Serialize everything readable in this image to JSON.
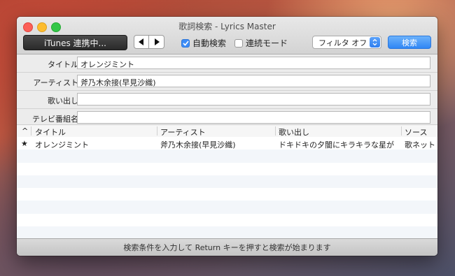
{
  "window": {
    "title": "歌詞検索 - Lyrics Master"
  },
  "toolbar": {
    "itunes_label": "iTunes 連携中...",
    "auto_search_label": "自動検索",
    "auto_search_checked": true,
    "continuous_label": "連続モード",
    "continuous_checked": false,
    "filter_value": "フィルタ オフ",
    "search_label": "検索"
  },
  "form": {
    "title_label": "タイトル",
    "title_value": "オレンジミント",
    "artist_label": "アーティスト",
    "artist_value": "斧乃木余接(早見沙織)",
    "intro_label": "歌い出し",
    "intro_value": "",
    "tv_label": "テレビ番組名",
    "tv_value": ""
  },
  "table": {
    "sort_indicator": "^",
    "columns": [
      "タイトル",
      "アーティスト",
      "歌い出し",
      "ソース"
    ],
    "rows": [
      {
        "star": "★",
        "title": "オレンジミント",
        "artist": "斧乃木余接(早見沙織)",
        "intro": "ドキドキの夕闇にキラキラな星が",
        "source": "歌ネット"
      }
    ]
  },
  "status": {
    "message": "検索条件を入力して Return キーを押すと検索が始まります"
  },
  "colors": {
    "accent": "#2f86f5",
    "close": "#fc5f57",
    "minimize": "#fdbc2e",
    "maximize": "#33c748"
  }
}
